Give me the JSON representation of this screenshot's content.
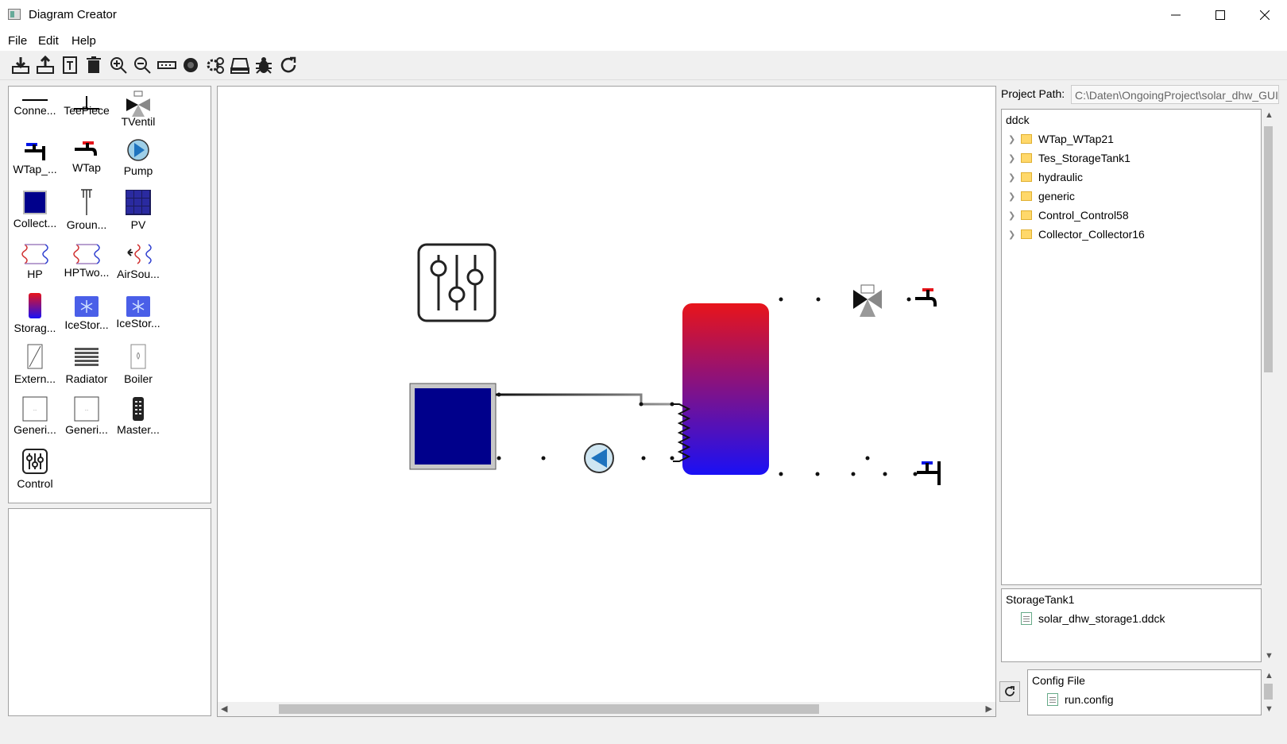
{
  "window": {
    "title": "Diagram Creator"
  },
  "menu": {
    "items": [
      "File",
      "Edit",
      "Help"
    ]
  },
  "toolbar": {
    "buttons": [
      "export-icon",
      "import-icon",
      "text-icon",
      "delete-icon",
      "zoom-in-icon",
      "zoom-out-icon",
      "label-toggle-icon",
      "settings-dial-icon",
      "gears-icon",
      "disk-icon",
      "bug-icon",
      "refresh-icon"
    ]
  },
  "library": {
    "items": [
      {
        "label": "Conne..."
      },
      {
        "label": "TeePiece"
      },
      {
        "label": "TVentil"
      },
      {
        "label": "WTap_..."
      },
      {
        "label": "WTap"
      },
      {
        "label": "Pump"
      },
      {
        "label": "Collect..."
      },
      {
        "label": "Groun..."
      },
      {
        "label": "PV"
      },
      {
        "label": "HP"
      },
      {
        "label": "HPTwo..."
      },
      {
        "label": "AirSou..."
      },
      {
        "label": "Storag..."
      },
      {
        "label": "IceStor..."
      },
      {
        "label": "IceStor..."
      },
      {
        "label": "Extern..."
      },
      {
        "label": "Radiator"
      },
      {
        "label": "Boiler"
      },
      {
        "label": "Generi..."
      },
      {
        "label": "Generi..."
      },
      {
        "label": "Master..."
      },
      {
        "label": "Control"
      }
    ]
  },
  "project": {
    "path_label": "Project Path:",
    "path_value": "C:\\Daten\\OngoingProject\\solar_dhw_GUI"
  },
  "file_tree": {
    "root": "ddck",
    "folders": [
      "WTap_WTap21",
      "Tes_StorageTank1",
      "hydraulic",
      "generic",
      "Control_Control58",
      "Collector_Collector16"
    ]
  },
  "storage_panel": {
    "title": "StorageTank1",
    "file": "solar_dhw_storage1.ddck"
  },
  "config_panel": {
    "title": "Config File",
    "file": "run.config"
  },
  "colors": {
    "collector": "#00008b",
    "tank_top": "#e8141a",
    "tank_bottom": "#1a10f5",
    "pump": "#1e73be"
  }
}
